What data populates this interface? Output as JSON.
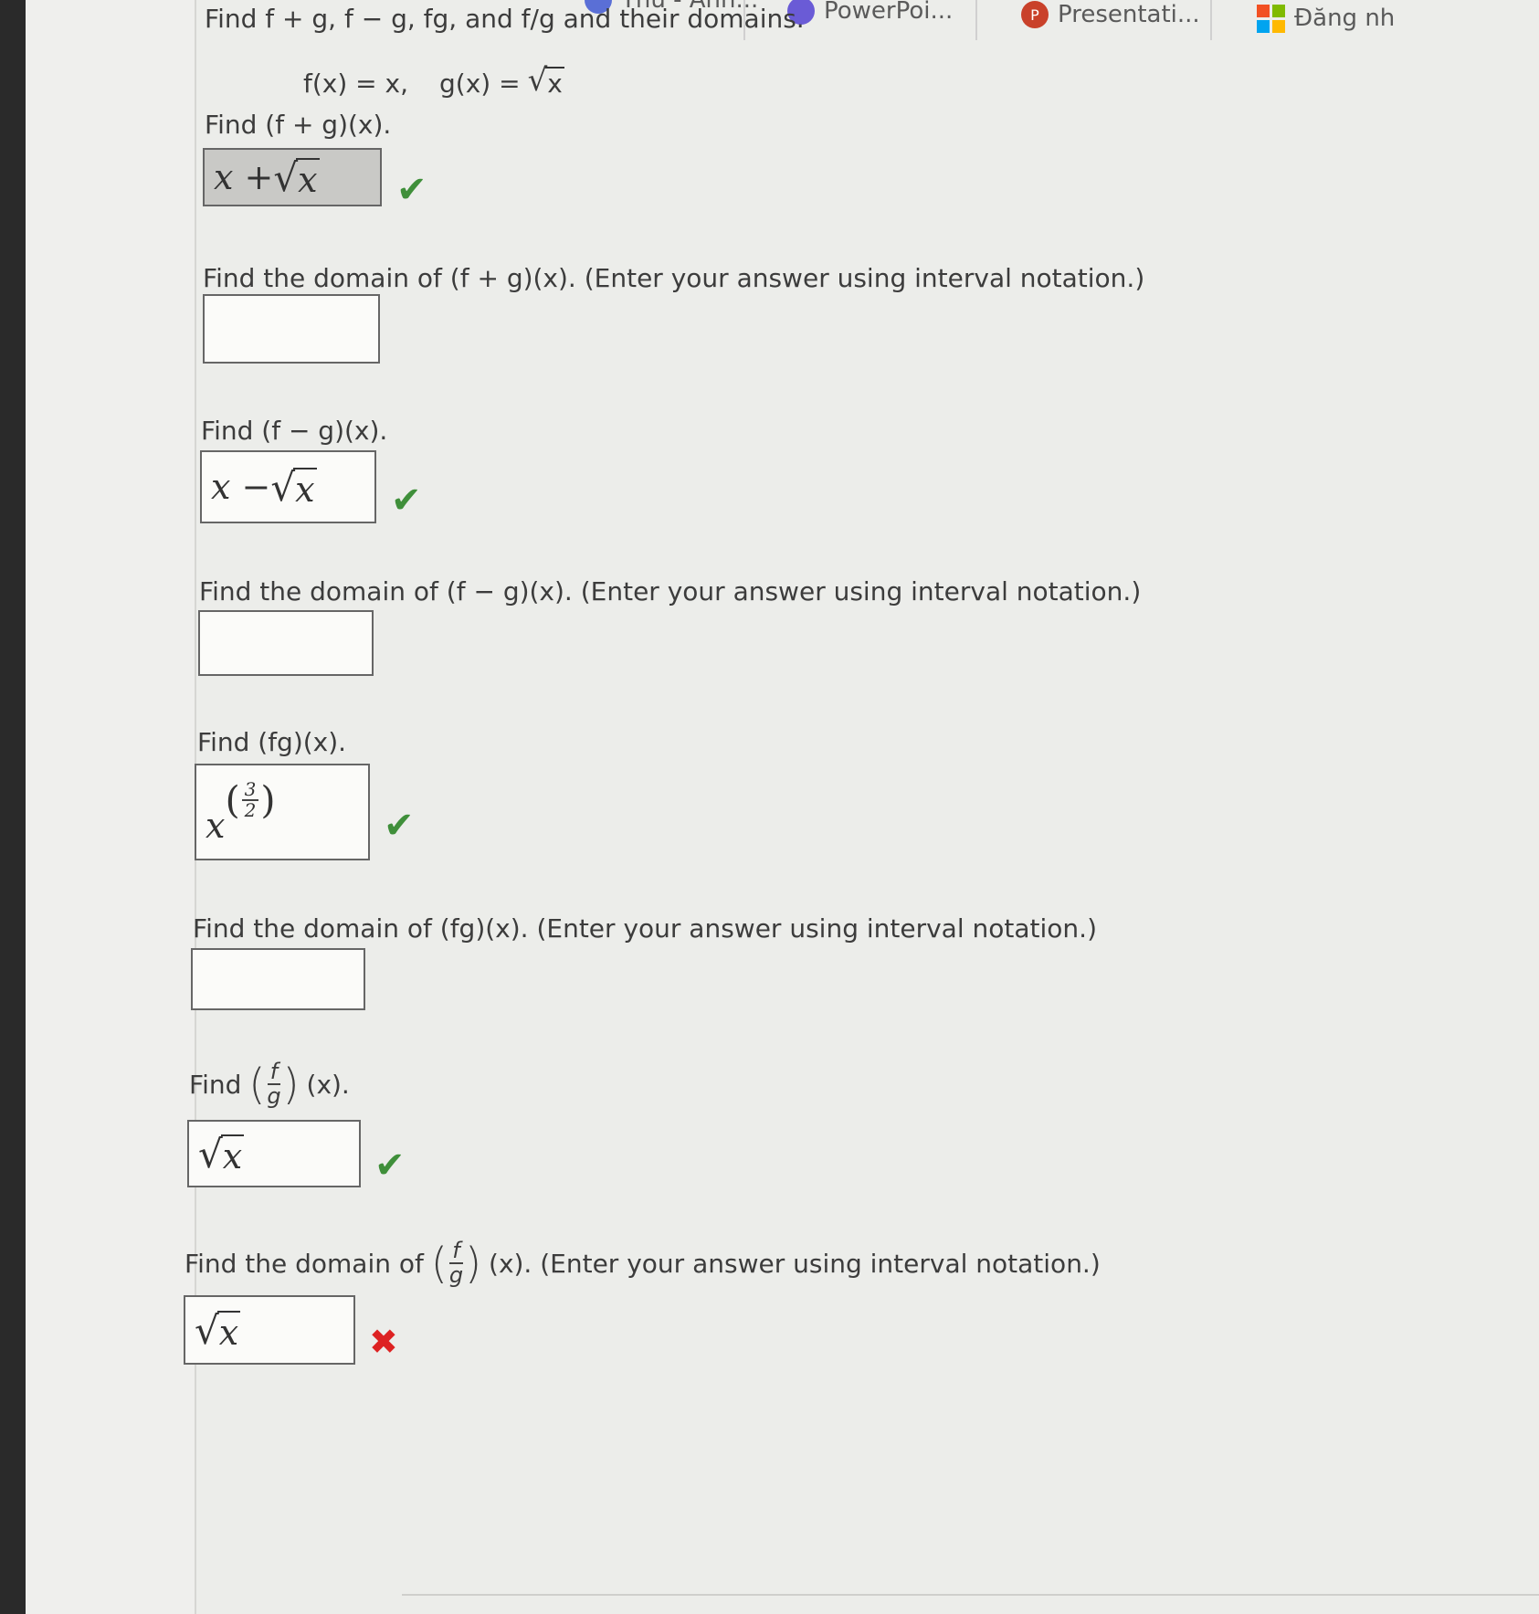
{
  "tabs": [
    {
      "label": "Thu - Anh...",
      "icon": "app-icon"
    },
    {
      "label": "PowerPoi...",
      "icon": "copilot-icon"
    },
    {
      "label": "Presentati...",
      "icon": "powerpoint-icon"
    },
    {
      "label": "Đăng nh",
      "icon": "microsoft-icon"
    }
  ],
  "problem": {
    "header": "Find f + g, f − g, fg, and f/g and their domains.",
    "definition_f": "f(x) = x,",
    "definition_g_prefix": "g(x) =",
    "definition_g_radicand": "x"
  },
  "questions": [
    {
      "prompt": "Find (f + g)(x).",
      "answer_prefix": "x + ",
      "answer_radicand": "x",
      "status": "correct"
    },
    {
      "prompt": "Find the domain of (f + g)(x). (Enter your answer using interval notation.)",
      "answer": "",
      "status": "none"
    },
    {
      "prompt": "Find (f − g)(x).",
      "answer_prefix": "x − ",
      "answer_radicand": "x",
      "status": "correct"
    },
    {
      "prompt": "Find the domain of (f − g)(x). (Enter your answer using interval notation.)",
      "answer": "",
      "status": "none"
    },
    {
      "prompt": "Find (fg)(x).",
      "answer_base": "x",
      "answer_exp_num": "3",
      "answer_exp_den": "2",
      "status": "correct"
    },
    {
      "prompt": "Find the domain of (fg)(x). (Enter your answer using interval notation.)",
      "answer": "",
      "status": "none"
    },
    {
      "prompt_prefix": "Find",
      "prompt_frac_num": "f",
      "prompt_frac_den": "g",
      "prompt_suffix": "(x).",
      "answer_radicand": "x",
      "status": "correct"
    },
    {
      "prompt_prefix": "Find the domain of",
      "prompt_frac_num": "f",
      "prompt_frac_den": "g",
      "prompt_suffix": "(x).  (Enter your answer using interval notation.)",
      "answer_radicand": "x",
      "status": "incorrect"
    }
  ],
  "marks": {
    "correct": "✔",
    "incorrect": "✖"
  },
  "colors": {
    "correct": "#3f8f3a",
    "incorrect": "#dd2222"
  }
}
